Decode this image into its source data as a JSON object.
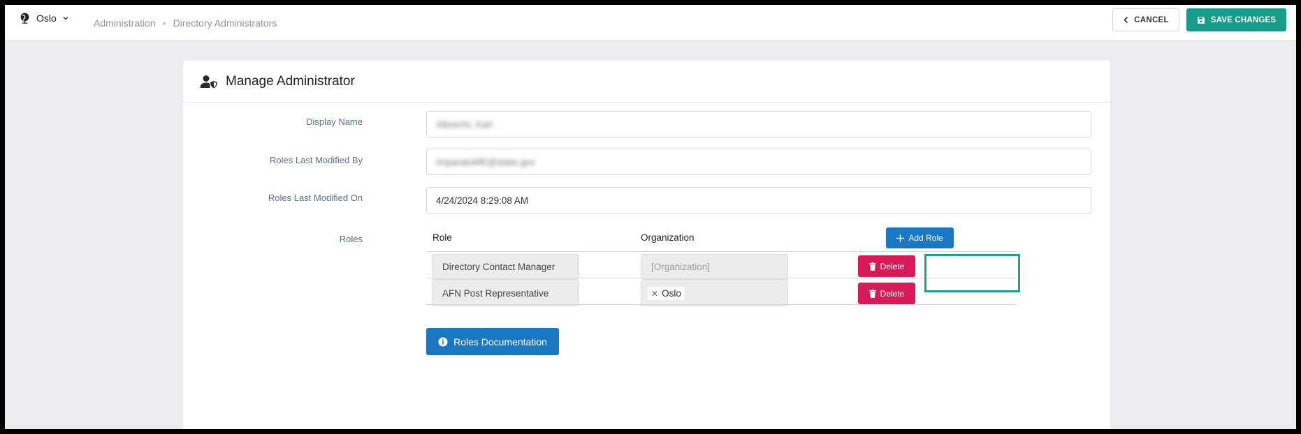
{
  "topbar": {
    "post_label": "Oslo",
    "breadcrumb": [
      "Administration",
      "Directory Administrators"
    ],
    "cancel_label": "CANCEL",
    "save_label": "SAVE CHANGES"
  },
  "card": {
    "title": "Manage Administrator",
    "fields": {
      "display_name": {
        "label": "Display Name",
        "value": "Albrecht, Karl"
      },
      "modified_by": {
        "label": "Roles Last Modified By",
        "value": "ImparatoME@state.gov"
      },
      "modified_on": {
        "label": "Roles Last Modified On",
        "value": "4/24/2024 8:29:08 AM"
      }
    },
    "roles": {
      "label": "Roles",
      "col_role": "Role",
      "col_org": "Organization",
      "add_label": "Add Role",
      "rows": [
        {
          "role": "Directory Contact Manager",
          "org_placeholder": "[Organization]",
          "org_tag": "",
          "delete_label": "Delete"
        },
        {
          "role": "AFN Post Representative",
          "org_placeholder": "",
          "org_tag": "Oslo",
          "delete_label": "Delete"
        }
      ]
    },
    "docs_label": "Roles Documentation"
  },
  "colors": {
    "primary": "#1a78c2",
    "save": "#179c8a",
    "delete": "#d81b57",
    "highlight": "#19a58f"
  },
  "icons": {
    "post": "globe-icon",
    "chevron": "chevron-down-icon",
    "cancel": "chevron-left-icon",
    "save": "save-icon",
    "header": "user-shield-icon",
    "add": "plus-icon",
    "delete": "trash-icon",
    "docs": "info-circle-icon",
    "remove_tag": "close-icon"
  }
}
